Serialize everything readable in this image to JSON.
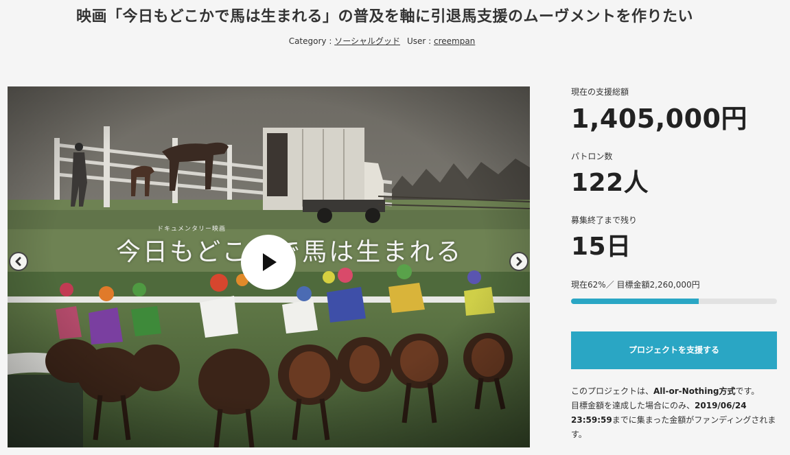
{
  "header": {
    "title": "映画「今日もどこかで馬は生まれる」の普及を軸に引退馬支援のムーヴメントを作りたい",
    "category_label": "Category : ",
    "category_value": "ソーシャルグッド",
    "user_label": "User : ",
    "user_value": "creempan"
  },
  "video": {
    "doc_label": "ドキュメンタリー映画",
    "film_title": "今日もどこかで馬は生まれる",
    "play_icon": "play-icon",
    "prev_icon": "chevron-left-icon",
    "next_icon": "chevron-right-icon"
  },
  "stats": {
    "total_label": "現在の支援総額",
    "total_value": "1,405,000円",
    "patrons_label": "パトロン数",
    "patrons_value": "122人",
    "remaining_label": "募集終了まで残り",
    "remaining_value": "15日"
  },
  "progress": {
    "current_prefix": "現在",
    "percent_text": "62%",
    "separator": "／ ",
    "goal_label": "目標金額",
    "goal_value": "2,260,000円",
    "percent": 62
  },
  "support_button": {
    "label": "プロジェクトを支援する"
  },
  "note": {
    "line1_pre": "このプロジェクトは、",
    "line1_bold": "All-or-Nothing方式",
    "line1_post": "です。",
    "line2_pre": "目標金額を達成した場合にのみ、",
    "deadline": "2019/06/24 23:59:59",
    "line2_post": "までに集まった金額がファンディングされます。"
  },
  "colors": {
    "accent": "#2aa6c4",
    "background": "#f5f5f5",
    "track": "#e2e2e2"
  }
}
